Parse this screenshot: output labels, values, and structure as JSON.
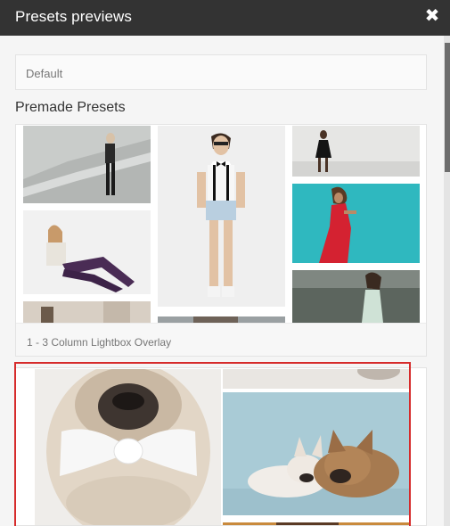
{
  "dialog": {
    "title": "Presets previews",
    "close_glyph": "✖"
  },
  "default_preset": {
    "label": "Default"
  },
  "premade": {
    "heading": "Premade Presets",
    "presets": [
      {
        "caption": "1 - 3 Column Lightbox Overlay"
      },
      {
        "caption": ""
      }
    ]
  },
  "colors": {
    "titlebar": "#333333",
    "selection": "#d62b2b",
    "background": "#f5f5f5"
  }
}
